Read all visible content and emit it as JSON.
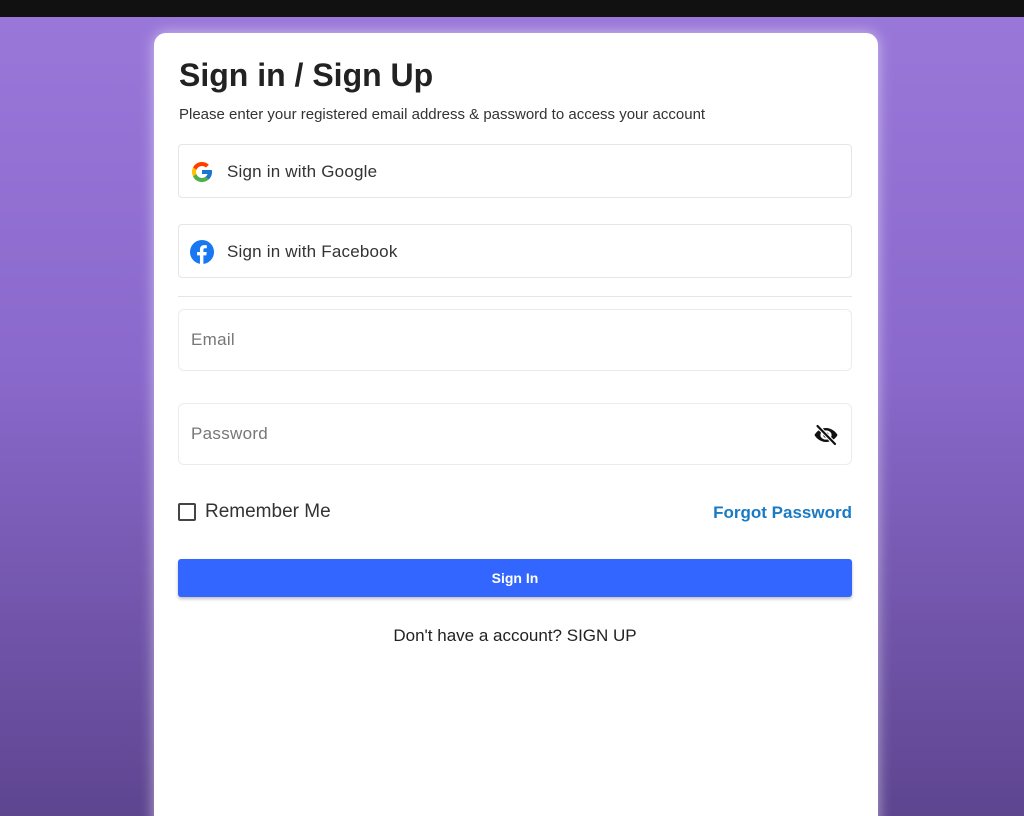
{
  "header": {
    "title": "Sign in / Sign Up",
    "subtitle": "Please enter your registered email address & password to access your account"
  },
  "social": {
    "google": {
      "label": "Sign in with Google",
      "icon": "google-icon"
    },
    "facebook": {
      "label": "Sign in with Facebook",
      "icon": "facebook-icon"
    }
  },
  "form": {
    "email": {
      "placeholder": "Email",
      "value": ""
    },
    "password": {
      "placeholder": "Password",
      "value": "",
      "toggle_icon": "eye-slash-icon"
    },
    "remember": {
      "label": "Remember Me",
      "checked": false
    },
    "forgot_label": "Forgot Password",
    "submit_label": "Sign In"
  },
  "footer": {
    "prompt": "Don't have a account?",
    "link": "SIGN UP"
  },
  "colors": {
    "background_top": "#9a78da",
    "background_bottom": "#5e4590",
    "primary_button": "#3366ff",
    "link": "#1a7bc4",
    "facebook_blue": "#1877f2"
  }
}
